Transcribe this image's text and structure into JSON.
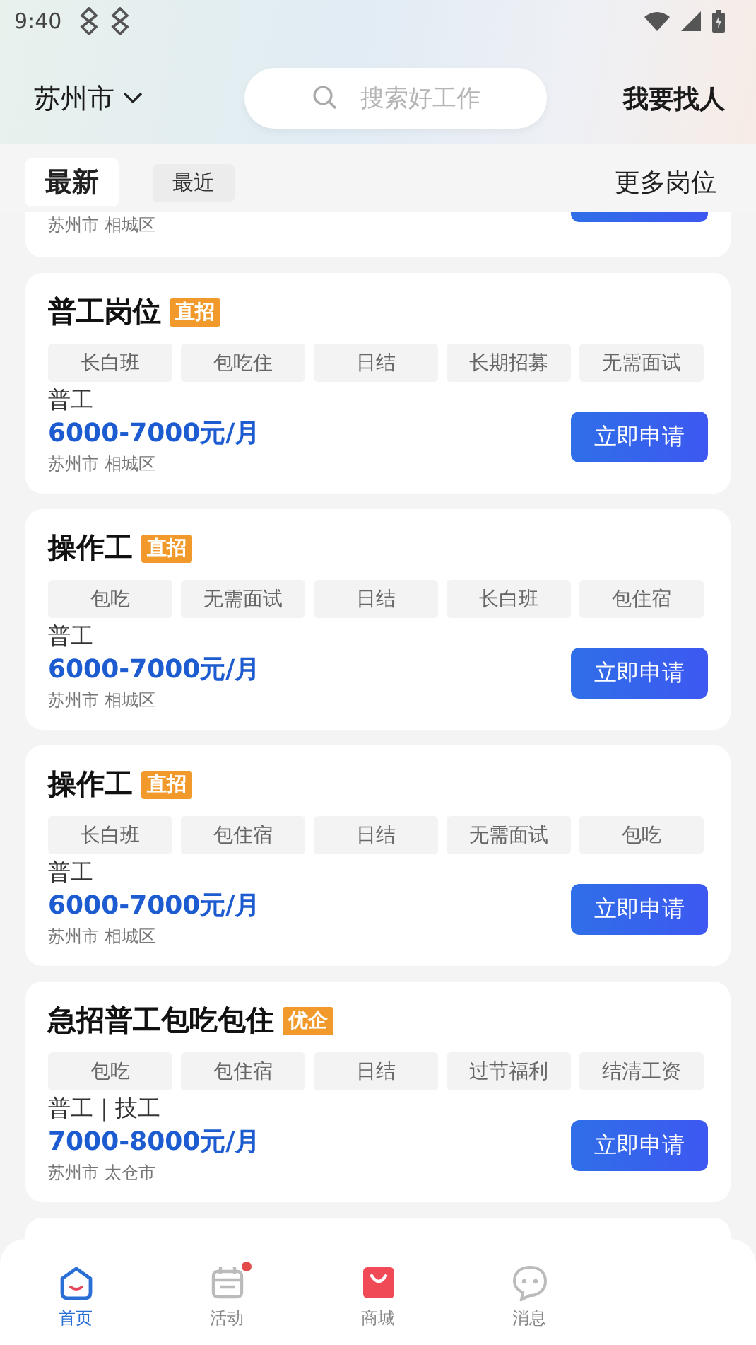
{
  "status_bar": {
    "time": "9:40"
  },
  "header": {
    "city": "苏州市",
    "search": {
      "placeholder": "搜索好工作"
    },
    "action": "我要找人"
  },
  "tabs": [
    {
      "label": "最新",
      "selected": true
    },
    {
      "label": "最近",
      "selected": false
    }
  ],
  "more_link": "更多岗位",
  "partial_card": {
    "location": "苏州市 相城区"
  },
  "jobs": [
    {
      "title": "普工岗位",
      "badge": "直招",
      "tags": [
        "长白班",
        "包吃住",
        "日结",
        "长期招募",
        "无需面试"
      ],
      "type": "普工",
      "salary": "6000-7000元/月",
      "location": "苏州市 相城区",
      "button": "立即申请"
    },
    {
      "title": "操作工",
      "badge": "直招",
      "tags": [
        "包吃",
        "无需面试",
        "日结",
        "长白班",
        "包住宿"
      ],
      "type": "普工",
      "salary": "6000-7000元/月",
      "location": "苏州市 相城区",
      "button": "立即申请"
    },
    {
      "title": "操作工",
      "badge": "直招",
      "tags": [
        "长白班",
        "包住宿",
        "日结",
        "无需面试",
        "包吃"
      ],
      "type": "普工",
      "salary": "6000-7000元/月",
      "location": "苏州市 相城区",
      "button": "立即申请"
    },
    {
      "title": "急招普工包吃包住",
      "badge": "优企",
      "tags": [
        "包吃",
        "包住宿",
        "日结",
        "过节福利",
        "结清工资"
      ],
      "type": "普工 | 技工",
      "salary": "7000-8000元/月",
      "location": "苏州市 太仓市",
      "button": "立即申请"
    }
  ],
  "bottom_nav": [
    {
      "kind": "home",
      "label": "首页",
      "selected": true,
      "dot": false
    },
    {
      "kind": "calendar",
      "label": "活动",
      "selected": false,
      "dot": true
    },
    {
      "kind": "shop",
      "label": "商城",
      "selected": false,
      "dot": false
    },
    {
      "kind": "chat",
      "label": "消息",
      "selected": false,
      "dot": false
    }
  ]
}
